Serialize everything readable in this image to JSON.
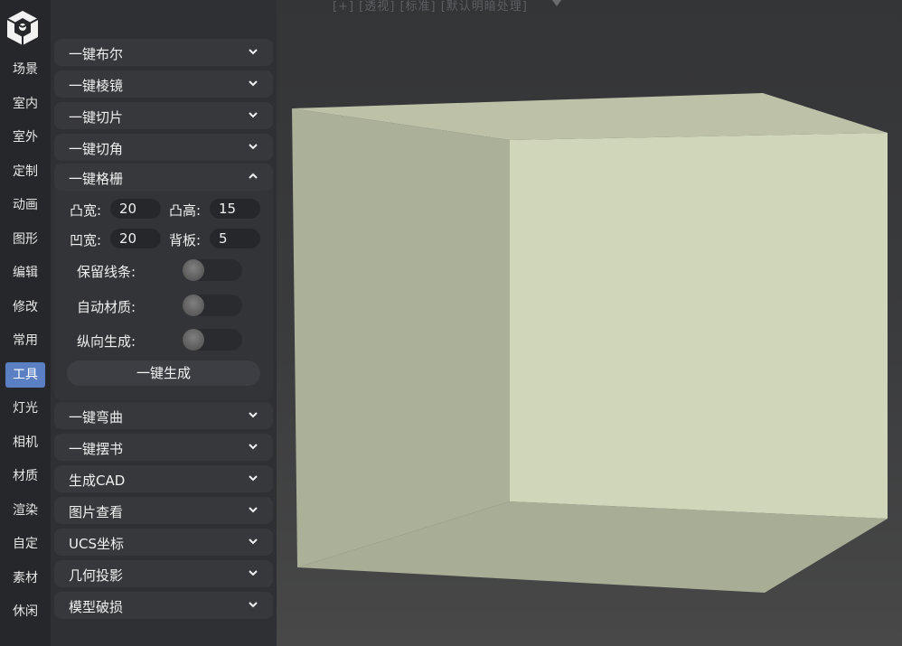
{
  "top_tabs": {
    "text": "[+] [透视] [标准] [默认明暗处理]"
  },
  "rail": {
    "items": [
      "场景",
      "室内",
      "室外",
      "定制",
      "动画",
      "图形",
      "编辑",
      "修改",
      "常用",
      "工具",
      "灯光",
      "相机",
      "材质",
      "渲染",
      "自定",
      "素材",
      "休闲"
    ],
    "active_index": 9,
    "active_color": "#5a7fc2"
  },
  "sections_top": [
    "一键布尔",
    "一键棱镜",
    "一键切片",
    "一键切角"
  ],
  "open_section": {
    "title": "一键格栅",
    "params": {
      "convex_width_label": "凸宽:",
      "convex_width_value": "20",
      "convex_height_label": "凸高:",
      "convex_height_value": "15",
      "concave_width_label": "凹宽:",
      "concave_width_value": "20",
      "back_label": "背板:",
      "back_value": "5"
    },
    "toggles": [
      "保留线条:",
      "自动材质:",
      "纵向生成:"
    ],
    "generate_label": "一键生成"
  },
  "sections_bottom": [
    "一键弯曲",
    "一键摆书",
    "生成CAD",
    "图片查看",
    "UCS坐标",
    "几何投影",
    "模型破损"
  ],
  "colors": {
    "box_front": "#d0d6ba",
    "box_side": "#abb199",
    "box_top": "#bcc1a8",
    "box_bottom": "#a8ad96"
  }
}
